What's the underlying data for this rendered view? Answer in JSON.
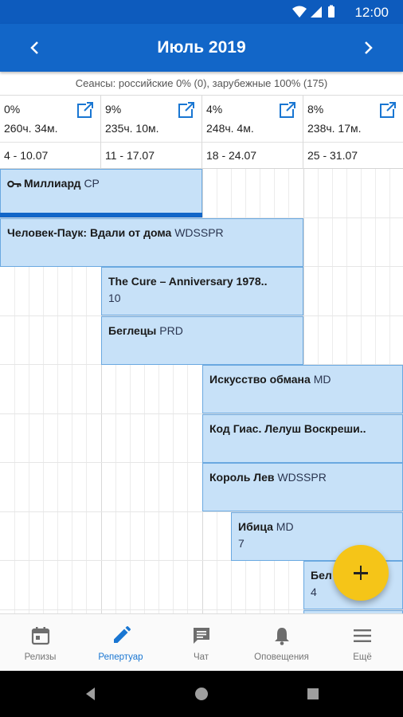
{
  "status": {
    "time": "12:00"
  },
  "header": {
    "title": "Июль 2019"
  },
  "summary": "Сеансы: российские 0% (0), зарубежные 100% (175)",
  "weeks": [
    {
      "percent": "0%",
      "hours": "260ч. 34м.",
      "range": "4 - 10.07"
    },
    {
      "percent": "9%",
      "hours": "235ч. 10м.",
      "range": "11 - 17.07"
    },
    {
      "percent": "4%",
      "hours": "248ч. 4м.",
      "range": "18 - 24.07"
    },
    {
      "percent": "8%",
      "hours": "238ч. 17м.",
      "range": "25 - 31.07"
    }
  ],
  "releases": [
    {
      "name": "Миллиард",
      "tag": "CP",
      "count": "",
      "has_key": true,
      "progress": 1.0
    },
    {
      "name": "Человек-Паук: Вдали от дома",
      "tag": "WDSSPR",
      "count": ""
    },
    {
      "name": "The Cure – Anniversary 1978..",
      "tag": "",
      "count": "10"
    },
    {
      "name": "Беглецы",
      "tag": "PRD",
      "count": ""
    },
    {
      "name": "Искусство обмана",
      "tag": "MD",
      "count": ""
    },
    {
      "name": "Код Гиас. Лелуш Воскреши..",
      "tag": "",
      "count": ""
    },
    {
      "name": "Король Лев",
      "tag": "WDSSPR",
      "count": ""
    },
    {
      "name": "Ибица",
      "tag": "MD",
      "count": "7"
    },
    {
      "name": "Бел",
      "tag": "",
      "count": "4"
    }
  ],
  "bottom_nav": [
    {
      "label": "Релизы",
      "icon": "calendar-icon",
      "active": false
    },
    {
      "label": "Репертуар",
      "icon": "pencil-icon",
      "active": true
    },
    {
      "label": "Чат",
      "icon": "chat-icon",
      "active": false
    },
    {
      "label": "Оповещения",
      "icon": "bell-icon",
      "active": false
    },
    {
      "label": "Ещё",
      "icon": "menu-icon",
      "active": false
    }
  ],
  "colors": {
    "primary": "#1266c8",
    "status_bar": "#0d5bbd",
    "bar_fill": "#c7e1f8",
    "bar_border": "#6aa8e0",
    "fab": "#f5c518",
    "active_tab": "#1976d2"
  }
}
